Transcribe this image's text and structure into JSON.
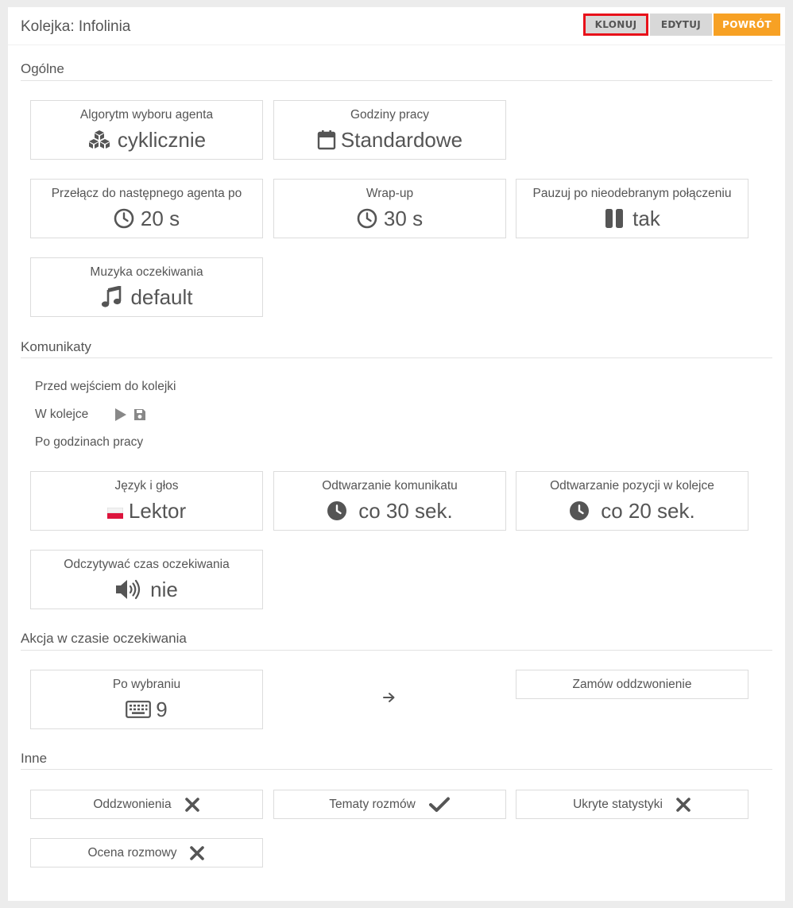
{
  "header": {
    "title": "Kolejka: Infolinia",
    "buttons": {
      "clone": "KLONUJ",
      "edit": "EDYTUJ",
      "back": "POWRÓT"
    }
  },
  "sections": {
    "general": "Ogólne",
    "messages": "Komunikaty",
    "wait_action": "Akcja w czasie oczekiwania",
    "other": "Inne"
  },
  "general": {
    "algorithm": {
      "label": "Algorytm wyboru agenta",
      "value": "cyklicznie",
      "icon": "cubes-icon"
    },
    "hours": {
      "label": "Godziny pracy",
      "value": "Standardowe",
      "icon": "calendar-icon"
    },
    "switch_agent": {
      "label": "Przełącz do następnego agenta po",
      "value": "20 s",
      "icon": "clock-icon"
    },
    "wrapup": {
      "label": "Wrap-up",
      "value": "30 s",
      "icon": "clock-icon"
    },
    "pause": {
      "label": "Pauzuj po nieodebranym połączeniu",
      "value": "tak",
      "icon": "pause-icon"
    },
    "music": {
      "label": "Muzyka oczekiwania",
      "value": "default",
      "icon": "music-icon"
    }
  },
  "messages": {
    "before_queue": "Przed wejściem do kolejki",
    "in_queue": "W kolejce",
    "after_hours": "Po godzinach pracy",
    "language": {
      "label": "Język i głos",
      "value": "Lektor",
      "icon": "flag-pl-icon"
    },
    "playback": {
      "label": "Odtwarzanie komunikatu",
      "value": "co 30 sek.",
      "icon": "clock-solid-icon"
    },
    "position": {
      "label": "Odtwarzanie pozycji w kolejce",
      "value": "co 20 sek.",
      "icon": "clock-solid-icon"
    },
    "read_wait": {
      "label": "Odczytywać czas oczekiwania",
      "value": "nie",
      "icon": "speaker-icon"
    }
  },
  "wait_action": {
    "on_press": {
      "label": "Po wybraniu",
      "value": "9",
      "icon": "keyboard-icon"
    },
    "arrow": "arrow-right-icon",
    "target": "Zamów oddzwonienie"
  },
  "other": {
    "callbacks": {
      "label": "Oddzwonienia",
      "state": "cross-icon"
    },
    "topics": {
      "label": "Tematy rozmów",
      "state": "check-icon"
    },
    "hidden_stats": {
      "label": "Ukryte statystyki",
      "state": "cross-icon"
    },
    "rating": {
      "label": "Ocena rozmowy",
      "state": "cross-icon"
    }
  },
  "colors": {
    "accent": "#f7a124",
    "button_gray": "#d8d8d8",
    "highlight": "#e8111a",
    "text": "#555555"
  }
}
